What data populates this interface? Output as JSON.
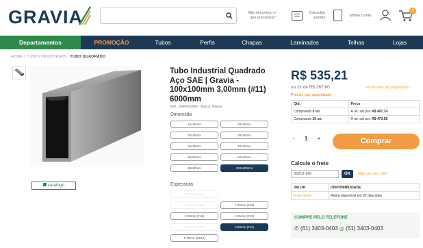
{
  "header": {
    "logo": "GRAVIA",
    "search_placeholder": "",
    "help_line1": "Não encontrou o",
    "help_line2": "que precisava?",
    "order_line1": "Consultar",
    "order_line2": "pedido",
    "account": "Minha Conta",
    "cart_count": "0"
  },
  "nav": {
    "items": [
      "Departamentos",
      "PROMOÇÃO",
      "Tubos",
      "Perfis",
      "Chapas",
      "Laminados",
      "Telhas",
      "Lojas"
    ]
  },
  "breadcrumb": {
    "home": "HOME",
    "sep": "/",
    "category": "TUBOS INDUSTRIAIS",
    "current": "TUBO QUADRADO"
  },
  "product": {
    "catalog": "catalogo",
    "title": "Tubo Industrial Quadrado Aço SAE | Gravia - 100x100mm 3,00mm (#11) 6000mm",
    "ref": "Ref.: 3000001880 · Marca: Gravia",
    "dimension_label": "Dimensão",
    "dimensions": [
      "15x15mm",
      "20x20mm",
      "25x25mm",
      "30x30mm",
      "35x35mm",
      "40x40mm",
      "50x50mm",
      "60x60mm",
      "80x80mm",
      "100x100mm"
    ],
    "thickness_label": "Espessura",
    "thickness": [
      "0,90mm (#20)",
      "1,20mm (#18)",
      "1,50mm (#16)",
      "1,90mm (#14)",
      "2,00mm (#14)",
      "2,25mm (#13)",
      "2,65mm (#12)",
      "3,00mm (#11)",
      "4,75mm (#3/16)"
    ]
  },
  "pricing": {
    "price": "R$ 535,21",
    "installments": "ou 2x de R$ 267,60",
    "payment_forms": "Ver formas de pagamento ›",
    "by_qty_label": "Preços por quantidade",
    "qty_header": "Qtd.",
    "price_header": "Preço",
    "rows": [
      {
        "qty_prefix": "Comprando ",
        "qty": "5 un.",
        "unit_prefix": "A un. sai por: ",
        "unit_price": "R$ 497,74"
      },
      {
        "qty_prefix": "Comprando ",
        "qty": "10 un.",
        "unit_prefix": "A un. sai por: ",
        "unit_price": "R$ 470,58"
      }
    ],
    "quantity": "1",
    "minus": "-",
    "plus": "+",
    "buy": "Comprar"
  },
  "shipping": {
    "title": "Calcule o frete",
    "cep_value": "95210-140",
    "ok": "OK",
    "no_cep": "Não sei meu CEP",
    "col_value": "VALOR",
    "col_avail": "DISPONIBILIDADE",
    "value": "Frete Grátis",
    "avail": "Retira disponível em 02 dias úteis"
  },
  "contact": {
    "title": "COMPRE PELO TELEFONE",
    "phone1": "(61) 3403-0403",
    "phone2": "(61) 3403-0403"
  },
  "colors": {
    "navy": "#1c3a57",
    "green": "#2e8a4a",
    "orange": "#f19b42"
  }
}
